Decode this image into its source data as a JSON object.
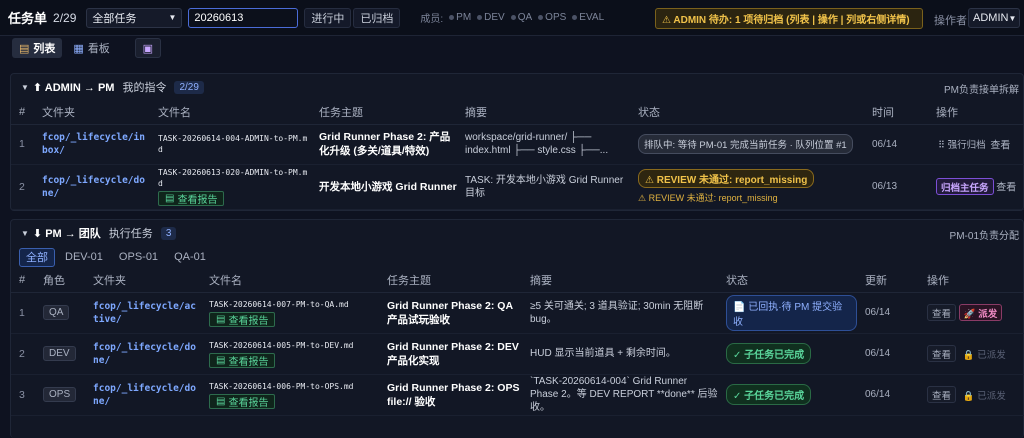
{
  "topbar": {
    "title": "任务单",
    "count": "2/29",
    "filter_select": "全部任务",
    "search_value": "20260613",
    "btn_in_progress": "进行中",
    "btn_archived": "已归档",
    "members_label": "成员:",
    "members": [
      "PM",
      "DEV",
      "QA",
      "OPS",
      "EVAL"
    ],
    "alert": "⚠ ADMIN 待办: 1 项待归档 (列表 | 操作 | 列或右侧详情)",
    "operator_label": "操作者",
    "operator_value": "ADMIN"
  },
  "views": {
    "list": "列表",
    "board": "看板"
  },
  "panel_admin": {
    "title": "⬆ ADMIN → PM",
    "subtitle": "我的指令",
    "badge": "2/29",
    "right_note": "PM负责接单拆解",
    "columns": [
      "#",
      "文件夹",
      "文件名",
      "任务主题",
      "摘要",
      "状态",
      "时间",
      "操作"
    ],
    "rows": [
      {
        "idx": "1",
        "folder": "fcop/_lifecycle/inbox/",
        "filename": "TASK-20260614-004-ADMIN-to-PM.md",
        "subject": "Grid Runner Phase 2: 产品化升级 (多关/道具/特效)",
        "summary": "workspace/grid-runner/ ├── index.html ├── style.css ├──...",
        "status": "排队中: 等待 PM-01 完成当前任务 · 队列位置 #1",
        "time": "06/14",
        "action1": "⠿ 强行归档",
        "action2": "查看"
      },
      {
        "idx": "2",
        "folder": "fcop/_lifecycle/done/",
        "filename": "TASK-20260613-020-ADMIN-to-PM.md",
        "report": "查看报告",
        "subject": "开发本地小游戏 Grid Runner",
        "summary": "TASK: 开发本地小游戏 Grid Runner 目标",
        "status": "⚠ REVIEW 未通过: report_missing",
        "status_sub": "⚠ REVIEW 未通过: report_missing",
        "time": "06/13",
        "action1": "归档主任务",
        "action2": "查看"
      }
    ]
  },
  "panel_pm": {
    "title": "⬇ PM → 团队",
    "subtitle": "执行任务",
    "badge": "3",
    "right_note": "PM-01负责分配",
    "filters": [
      "全部",
      "DEV-01",
      "OPS-01",
      "QA-01"
    ],
    "columns": [
      "#",
      "角色",
      "文件夹",
      "文件名",
      "任务主题",
      "摘要",
      "状态",
      "更新",
      "操作"
    ],
    "rows": [
      {
        "idx": "1",
        "role": "QA",
        "folder": "fcop/_lifecycle/active/",
        "filename": "TASK-20260614-007-PM-to-QA.md",
        "report": "查看报告",
        "subject": "Grid Runner Phase 2: QA 产品试玩验收",
        "summary": "≥5 关可通关; 3 道具验证; 30min 无阻断 bug。",
        "status": "📄 已回执·待 PM 提交验收",
        "time": "06/14",
        "action1": "查看",
        "action2": "🚀 派发"
      },
      {
        "idx": "2",
        "role": "DEV",
        "folder": "fcop/_lifecycle/done/",
        "filename": "TASK-20260614-005-PM-to-DEV.md",
        "report": "查看报告",
        "subject": "Grid Runner Phase 2: DEV 产品化实现",
        "summary": "HUD 显示当前道具 + 剩余时间。",
        "status": "✓ 子任务已完成",
        "time": "06/14",
        "action1": "查看",
        "action2": "🔒 已派发"
      },
      {
        "idx": "3",
        "role": "OPS",
        "folder": "fcop/_lifecycle/done/",
        "filename": "TASK-20260614-006-PM-to-OPS.md",
        "report": "查看报告",
        "subject": "Grid Runner Phase 2: OPS file:// 验收",
        "summary": "`TASK-20260614-004` Grid Runner Phase 2。等 DEV REPORT **done** 后验收。",
        "status": "✓ 子任务已完成",
        "time": "06/14",
        "action1": "查看",
        "action2": "🔒 已派发"
      }
    ]
  }
}
